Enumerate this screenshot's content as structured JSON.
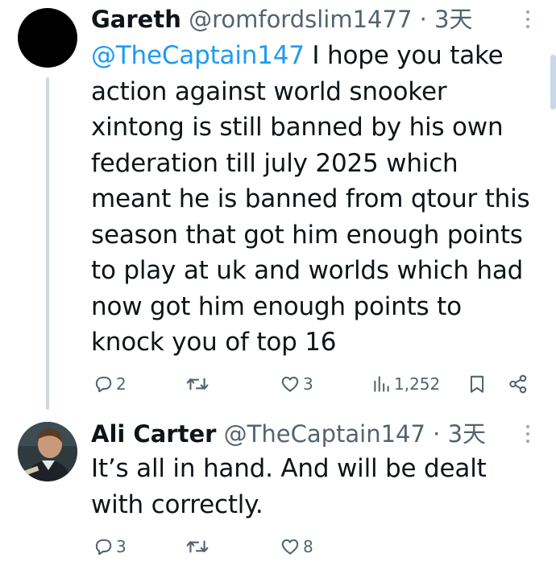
{
  "tweets": [
    {
      "display_name": "Gareth",
      "handle": "@romfordslim1477",
      "separator": "·",
      "time": "3天",
      "mention": "@TheCaptain147",
      "text_lines": [
        " I hope you take",
        "action against world snooker",
        "xintong is still banned by his own",
        "federation till july 2025 which",
        "meant he is banned from qtour this",
        "season that got him enough points",
        "to play at uk and worlds which had",
        "now got him enough points to",
        "knock you of top 16"
      ],
      "actions": {
        "reply_count": "2",
        "retweet_count": "",
        "like_count": "3",
        "view_count": "1,252"
      }
    },
    {
      "display_name": "Ali Carter",
      "handle": "@TheCaptain147",
      "separator": "·",
      "time": "3天",
      "text_lines": [
        "It’s all in hand. And will be dealt",
        "with correctly."
      ],
      "actions": {
        "reply_count": "3",
        "retweet_count": "",
        "like_count": "8"
      }
    }
  ],
  "icons": {
    "reply": "reply-icon",
    "retweet": "retweet-icon",
    "like": "heart-icon",
    "views": "views-icon",
    "bookmark": "bookmark-icon",
    "share": "share-icon",
    "more": "more-icon"
  },
  "colors": {
    "link": "#1d9bf0",
    "secondary_text": "#536471",
    "primary_text": "#0f1419",
    "thread_line": "#cfd9de"
  }
}
